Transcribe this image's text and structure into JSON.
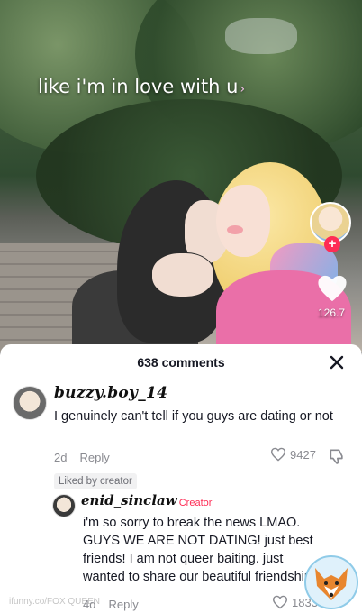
{
  "video": {
    "caption": "like i'm in love with u",
    "caption_arrow": "›",
    "like_count": "126.7"
  },
  "comments_panel": {
    "count_label": "638 comments",
    "close_icon": "close-icon"
  },
  "comments": [
    {
      "username": "buzzy.boy_14",
      "text": "I genuinely can't tell if you guys are dating or not",
      "age": "2d",
      "reply_label": "Reply",
      "likes": "9427",
      "liked_by_creator": "Liked by creator"
    },
    {
      "username": "enid_sinclaw",
      "creator_label": "Creator",
      "text_lines": [
        "i'm so sorry to break the news LMAO.",
        "GUYS WE ARE NOT DATING! just best",
        "friends! I am not queer baiting. just",
        "wanted to share our beautiful friendship"
      ],
      "age": "4d",
      "reply_label": "Reply",
      "likes": "1833"
    }
  ],
  "watermark": "ifunny.co/FOX QUEEN",
  "colors": {
    "accent": "#fe2c55",
    "text_primary": "#161823",
    "text_secondary": "#8a8b91"
  }
}
